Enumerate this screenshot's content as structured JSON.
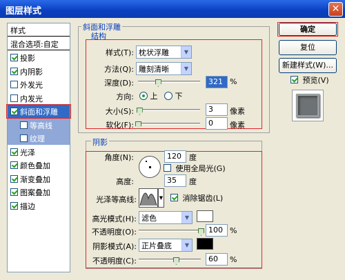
{
  "window": {
    "title": "图层样式",
    "close_glyph": "✕"
  },
  "left_panel": {
    "header": "样式",
    "blend_options": "混合选项:自定",
    "items": [
      {
        "label": "投影",
        "checked": true
      },
      {
        "label": "内阴影",
        "checked": true
      },
      {
        "label": "外发光",
        "checked": false
      },
      {
        "label": "内发光",
        "checked": false
      },
      {
        "label": "斜面和浮雕",
        "checked": true,
        "selected": true
      },
      {
        "label": "等高线",
        "checked": false,
        "sub": true
      },
      {
        "label": "纹理",
        "checked": false,
        "sub": true
      },
      {
        "label": "光泽",
        "checked": true
      },
      {
        "label": "颜色叠加",
        "checked": true
      },
      {
        "label": "渐变叠加",
        "checked": true
      },
      {
        "label": "图案叠加",
        "checked": true
      },
      {
        "label": "描边",
        "checked": true
      }
    ]
  },
  "bevel": {
    "group_title": "斜面和浮雕",
    "structure_title": "结构",
    "style_label": "样式(T):",
    "style_value": "枕状浮雕",
    "method_label": "方法(Q):",
    "method_value": "雕刻清晰",
    "depth_label": "深度(D):",
    "depth_value": "321",
    "depth_unit": "%",
    "depth_slider": 0.32,
    "direction_label": "方向:",
    "dir_up": "上",
    "dir_down": "下",
    "direction": "up",
    "size_label": "大小(S):",
    "size_value": "3",
    "size_unit": "像素",
    "size_slider": 0.02,
    "soften_label": "软化(F):",
    "soften_value": "0",
    "soften_unit": "像素",
    "soften_slider": 0.0
  },
  "shading": {
    "title": "阴影",
    "angle_label": "角度(N):",
    "angle_value": "120",
    "angle_unit": "度",
    "global_light_label": "使用全局光(G)",
    "global_light": false,
    "altitude_label": "高度:",
    "altitude_value": "35",
    "altitude_unit": "度",
    "gloss_label": "光泽等高线:",
    "anti_alias_label": "消除锯齿(L)",
    "anti_alias": true,
    "highlight_mode_label": "高光模式(H):",
    "highlight_mode_value": "滤色",
    "highlight_color": "#ffffff",
    "highlight_opacity_label": "不透明度(O):",
    "highlight_opacity_value": "100",
    "highlight_opacity_unit": "%",
    "highlight_opacity_slider": 1.0,
    "shadow_mode_label": "阴影模式(A):",
    "shadow_mode_value": "正片叠底",
    "shadow_color": "#000000",
    "shadow_opacity_label": "不透明度(C):",
    "shadow_opacity_value": "60",
    "shadow_opacity_unit": "%",
    "shadow_opacity_slider": 0.6
  },
  "buttons": {
    "ok": "确定",
    "reset": "复位",
    "new_style": "新建样式(W)...",
    "preview_label": "预览(V)",
    "preview": true
  },
  "colors": {
    "accent": "#316ac5",
    "highlight_red": "#e0262a"
  }
}
